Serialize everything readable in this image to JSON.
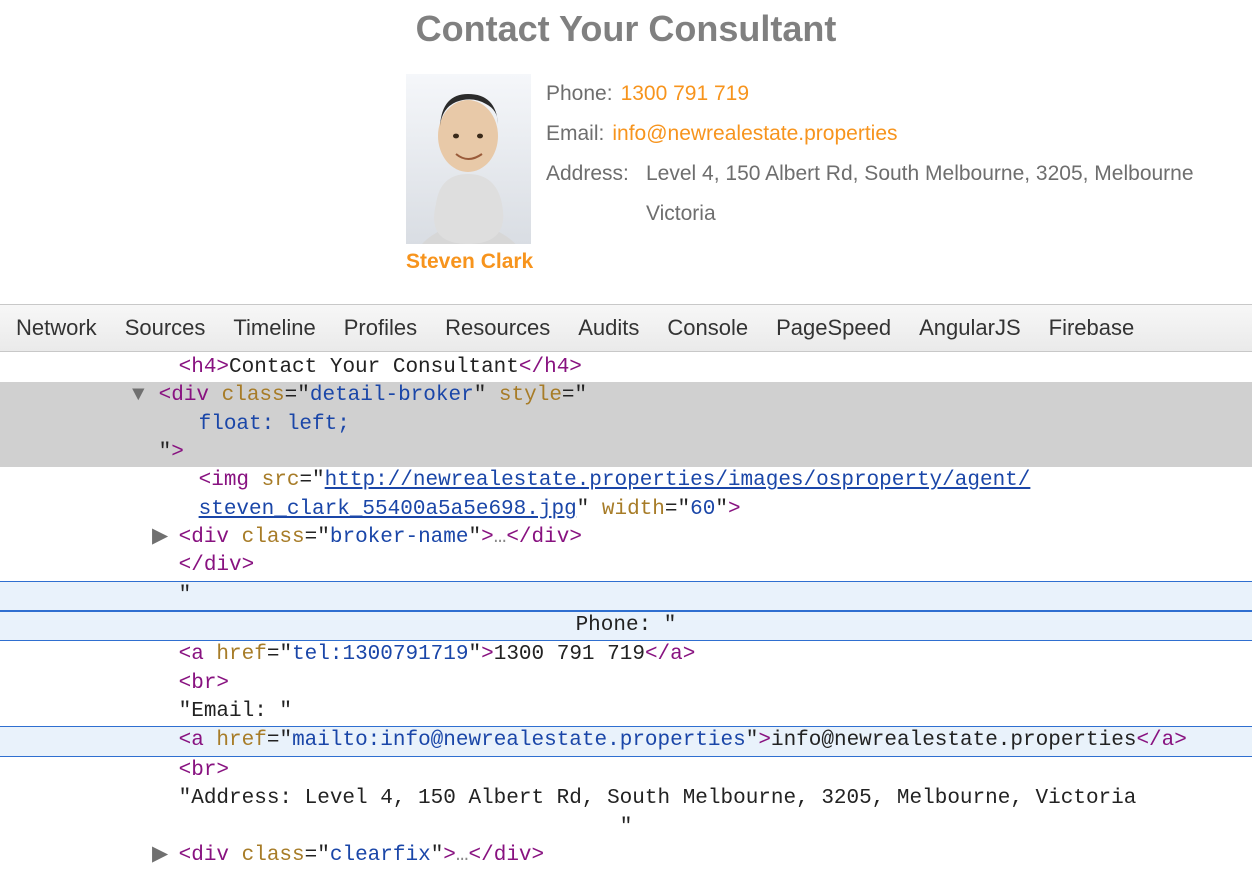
{
  "page": {
    "heading": "Contact Your Consultant",
    "broker_name": "Steven Clark",
    "phone_label": "Phone:",
    "phone_value": "1300 791 719",
    "email_label": "Email:",
    "email_value": "info@newrealestate.properties",
    "address_label": "Address:",
    "address_line1": "Level 4, 150 Albert Rd, South Melbourne, 3205, Melbourne",
    "address_line2": "Victoria"
  },
  "devtools": {
    "tabs": [
      "Network",
      "Sources",
      "Timeline",
      "Profiles",
      "Resources",
      "Audits",
      "Console",
      "PageSpeed",
      "AngularJS",
      "Firebase"
    ],
    "dom_lines": [
      {
        "indent": 0,
        "twisty": "",
        "html": "<span class='tag'>&lt;h4&gt;</span><span class='text'>Contact Your Consultant</span><span class='tag'>&lt;/h4&gt;</span>"
      },
      {
        "indent": -1,
        "twisty": "▼",
        "sel": true,
        "html": "<span class='tag'>&lt;div </span><span class='attr-name'>class</span><span class='text'>=\"</span><span class='attr-val'>detail-broker</span><span class='text'>\" </span><span class='attr-name'>style</span><span class='text'>=\"</span>"
      },
      {
        "indent": 1,
        "twisty": "",
        "sel": true,
        "html": "<span class='attr-val'>float: left;</span>"
      },
      {
        "indent": -1,
        "twisty": "",
        "sel": true,
        "html": "<span class='text'>\"</span><span class='tag'>&gt;</span>"
      },
      {
        "indent": 1,
        "twisty": "",
        "html": "<span class='tag'>&lt;img </span><span class='attr-name'>src</span><span class='text'>=\"</span><span class='attr-url'>http://newrealestate.properties/images/osproperty/agent/</span>"
      },
      {
        "indent": 1,
        "twisty": "",
        "html": "<span class='attr-url'>steven_clark_55400a5a5e698.jpg</span><span class='text'>\" </span><span class='attr-name'>width</span><span class='text'>=\"</span><span class='attr-val'>60</span><span class='text'>\"</span><span class='tag'>&gt;</span>"
      },
      {
        "indent": 0,
        "twisty": "▶",
        "html": "<span class='tag'>&lt;div </span><span class='attr-name'>class</span><span class='text'>=\"</span><span class='attr-val'>broker-name</span><span class='text'>\"</span><span class='tag'>&gt;</span><span class='gray'>…</span><span class='tag'>&lt;/div&gt;</span>"
      },
      {
        "indent": 0,
        "twisty": "",
        "html": "<span class='tag'>&lt;/div&gt;</span>"
      },
      {
        "indent": 0,
        "twisty": "",
        "hover": true,
        "html": "<span class='text'>\"</span>"
      },
      {
        "indent": 0,
        "twisty": "",
        "hover": true,
        "center": true,
        "html": "<span class='text'>Phone: \"</span>"
      },
      {
        "indent": 0,
        "twisty": "",
        "html": "<span class='tag'>&lt;a </span><span class='attr-name'>href</span><span class='text'>=\"</span><span class='attr-val'>tel:1300791719</span><span class='text'>\"</span><span class='tag'>&gt;</span><span class='text'>1300 791 719</span><span class='tag'>&lt;/a&gt;</span>"
      },
      {
        "indent": 0,
        "twisty": "",
        "html": "<span class='tag'>&lt;br&gt;</span>"
      },
      {
        "indent": 0,
        "twisty": "",
        "html": "<span class='text'>\"Email: \"</span>"
      },
      {
        "indent": 0,
        "twisty": "",
        "hover": true,
        "html": "<span class='tag'>&lt;a </span><span class='attr-name'>href</span><span class='text'>=\"</span><span class='attr-val'>mailto:info@newrealestate.properties</span><span class='text'>\"</span><span class='tag'>&gt;</span><span class='text'>info@newrealestate.properties</span><span class='tag'>&lt;/a&gt;</span>"
      },
      {
        "indent": 0,
        "twisty": "",
        "html": "<span class='tag'>&lt;br&gt;</span>"
      },
      {
        "indent": 0,
        "twisty": "",
        "html": "<span class='text'>\"Address: Level 4, 150 Albert Rd, South Melbourne, 3205, Melbourne, Victoria</span>"
      },
      {
        "indent": 0,
        "twisty": "",
        "center": true,
        "html": "<span class='text'>\"</span>"
      },
      {
        "indent": 0,
        "twisty": "▶",
        "html": "<span class='tag'>&lt;div </span><span class='attr-name'>class</span><span class='text'>=\"</span><span class='attr-val'>clearfix</span><span class='text'>\"</span><span class='tag'>&gt;</span><span class='gray'>…</span><span class='tag'>&lt;/div&gt;</span>"
      }
    ]
  }
}
